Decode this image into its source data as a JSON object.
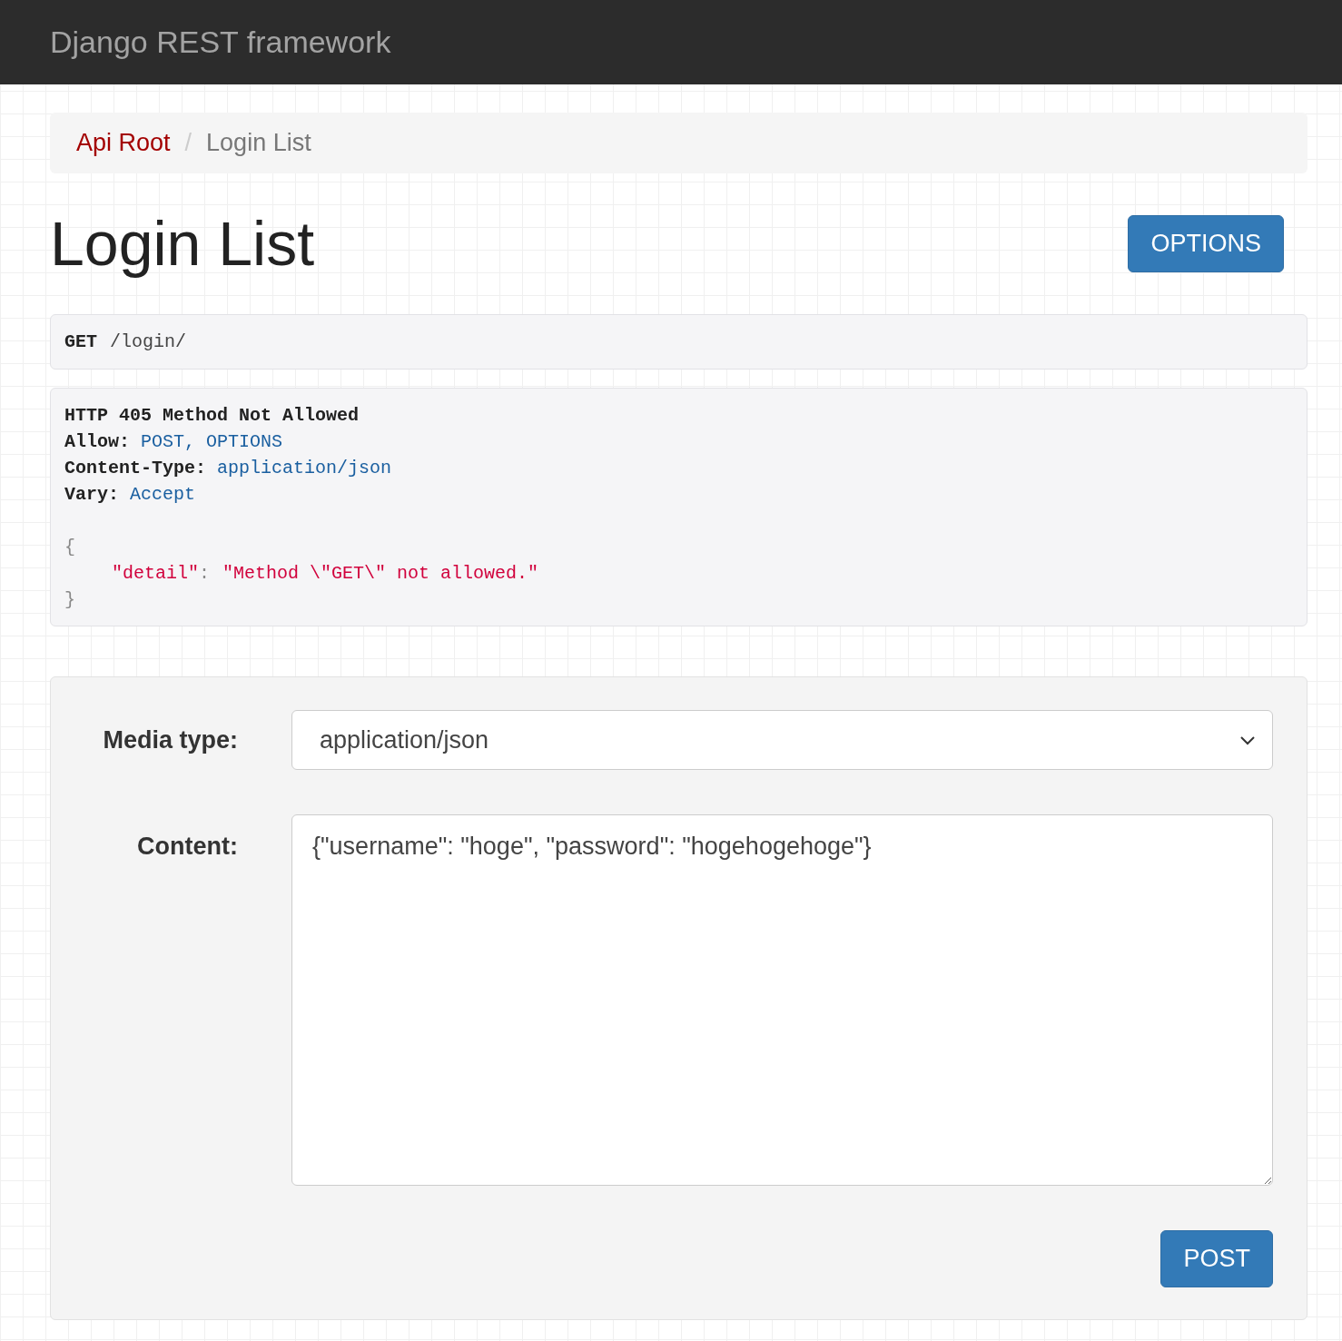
{
  "navbar": {
    "brand": "Django REST framework"
  },
  "breadcrumb": {
    "separator": "/",
    "items": [
      {
        "label": "Api Root",
        "selected": false
      },
      {
        "label": "Login List",
        "selected": true
      }
    ]
  },
  "page_title": "Login List",
  "options_button": "OPTIONS",
  "request": {
    "method": "GET",
    "path": "/login/"
  },
  "response": {
    "status_line": "HTTP 405 Method Not Allowed",
    "headers": [
      {
        "name": "Allow:",
        "value": "POST, OPTIONS"
      },
      {
        "name": "Content-Type:",
        "value": "application/json"
      },
      {
        "name": "Vary:",
        "value": "Accept"
      }
    ],
    "body": {
      "open": "{",
      "entries": [
        {
          "key": "\"detail\"",
          "separator": ":",
          "value": "\"Method \\\"GET\\\" not allowed.\""
        }
      ],
      "close": "}"
    }
  },
  "form": {
    "media_type_label": "Media type:",
    "media_type_value": "application/json",
    "content_label": "Content:",
    "content_value": "{\"username\": \"hoge\", \"password\": \"hogehogehoge\"}",
    "submit": "POST"
  }
}
